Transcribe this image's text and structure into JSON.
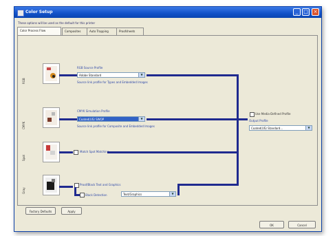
{
  "window": {
    "title": "Color Setup",
    "subtitle": "These options will be used as the default for this printer"
  },
  "tabs": [
    {
      "label": "Color Process Flow",
      "active": true
    },
    {
      "label": "Composites"
    },
    {
      "label": "Auto Trapping"
    },
    {
      "label": "Proofsheets"
    }
  ],
  "sections": {
    "rgb": {
      "side_label": "RGB",
      "field_label": "RGB Source Profile",
      "combo_value": "Adobe Standard",
      "note": "Source link profile for Types and Embedded Images"
    },
    "cmyk": {
      "side_label": "CMYK",
      "field_label": "CMYK Simulation Profile",
      "combo_value": "Coated(US) SWOP",
      "note": "Source link profile for Composite and Embedded Images"
    },
    "spot": {
      "side_label": "Spot",
      "checkbox_label": "Match Spot Matching"
    },
    "gray": {
      "side_label": "Gray",
      "checkbox_label": "Proof/Black Text and Graphics",
      "subfield_label": "Black Detection",
      "sub_combo_value": "Text/Graphics"
    }
  },
  "output": {
    "checkbox_label": "Use Media-Defined Profile",
    "field_label": "Output Profile",
    "combo_value": "Coated(US) Standard..."
  },
  "buttons": {
    "defaults": "Factory Defaults",
    "apply": "Apply",
    "ok": "OK",
    "cancel": "Cancel"
  },
  "colors": {
    "titlebar": "#1151c8",
    "flow_line": "#1f2a8f",
    "window_bg": "#ece9d8",
    "selection": "#3162c5"
  }
}
